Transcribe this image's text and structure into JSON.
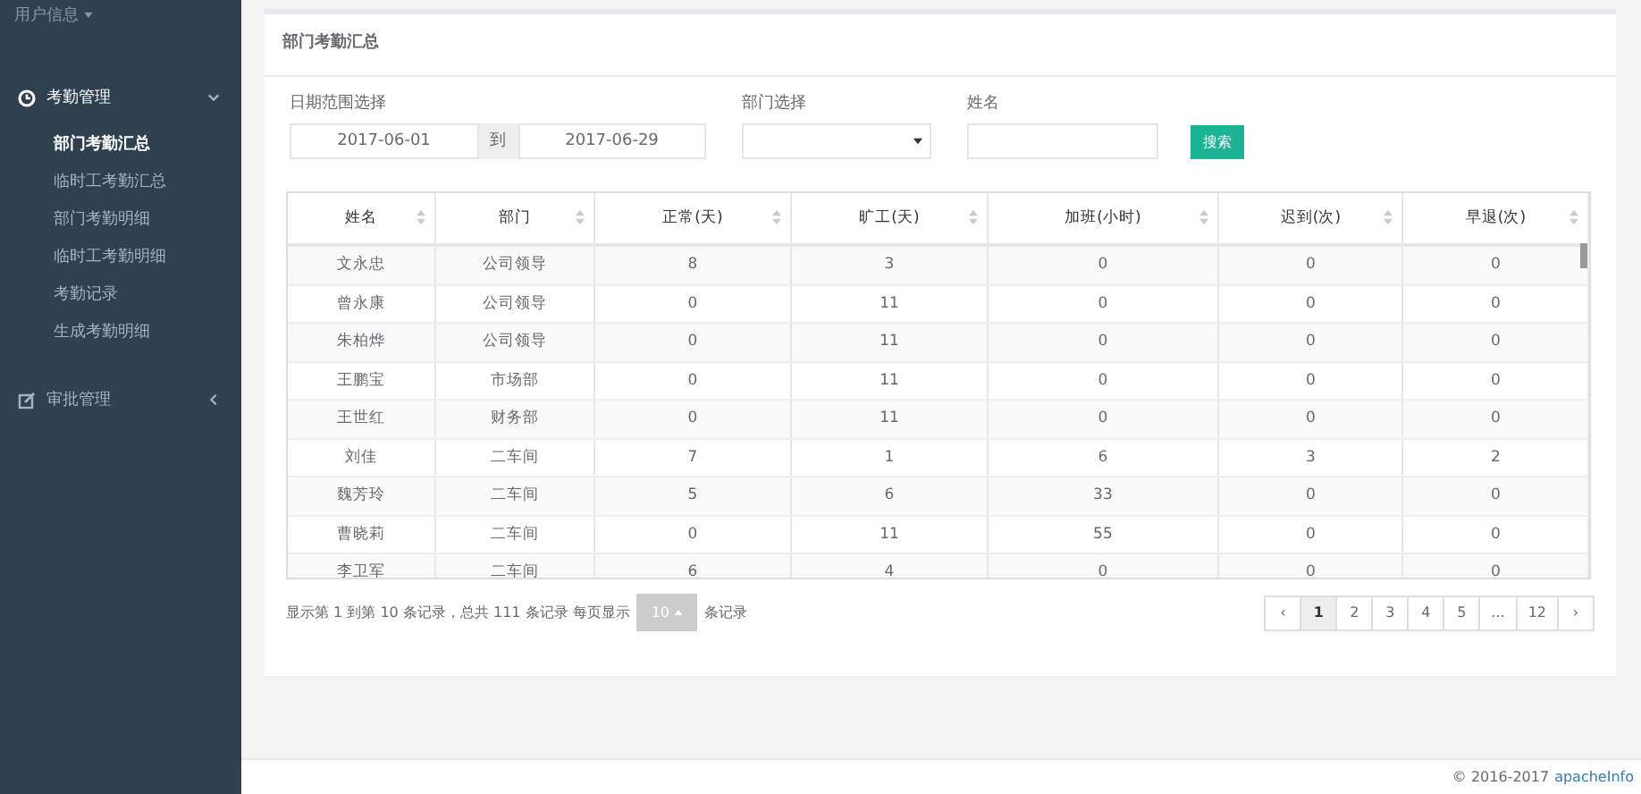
{
  "sidebar": {
    "user": {
      "label": "用户信息"
    },
    "menus": [
      {
        "label": "考勤管理",
        "expanded": true,
        "children": [
          {
            "label": "部门考勤汇总",
            "selected": true
          },
          {
            "label": "临时工考勤汇总",
            "selected": false
          },
          {
            "label": "部门考勤明细",
            "selected": false
          },
          {
            "label": "临时工考勤明细",
            "selected": false
          },
          {
            "label": "考勤记录",
            "selected": false
          },
          {
            "label": "生成考勤明细",
            "selected": false
          }
        ]
      },
      {
        "label": "审批管理",
        "expanded": false
      }
    ]
  },
  "panel": {
    "title": "部门考勤汇总",
    "filters": {
      "date_label": "日期范围选择",
      "date_from": "2017-06-01",
      "date_sep": "到",
      "date_to": "2017-06-29",
      "dept_label": "部门选择",
      "name_label": "姓名",
      "search_button": "搜索"
    },
    "table": {
      "columns": [
        "姓名",
        "部门",
        "正常(天)",
        "旷工(天)",
        "加班(小时)",
        "迟到(次)",
        "早退(次)"
      ],
      "rows": [
        [
          "文永忠",
          "公司领导",
          "8",
          "3",
          "0",
          "0",
          "0"
        ],
        [
          "曾永康",
          "公司领导",
          "0",
          "11",
          "0",
          "0",
          "0"
        ],
        [
          "朱柏烨",
          "公司领导",
          "0",
          "11",
          "0",
          "0",
          "0"
        ],
        [
          "王鹏宝",
          "市场部",
          "0",
          "11",
          "0",
          "0",
          "0"
        ],
        [
          "王世红",
          "财务部",
          "0",
          "11",
          "0",
          "0",
          "0"
        ],
        [
          "刘佳",
          "二车间",
          "7",
          "1",
          "6",
          "3",
          "2"
        ],
        [
          "魏芳玲",
          "二车间",
          "5",
          "6",
          "33",
          "0",
          "0"
        ],
        [
          "曹晓莉",
          "二车间",
          "0",
          "11",
          "55",
          "0",
          "0"
        ],
        [
          "李卫军",
          "二车间",
          "6",
          "4",
          "0",
          "0",
          "0"
        ]
      ]
    },
    "pagination": {
      "info_prefix": "显示第 1 到第 10 条记录，总共 111 条记录 每页显示",
      "page_size": "10",
      "info_suffix": "条记录",
      "pages": [
        {
          "label": "‹",
          "selected": false
        },
        {
          "label": "1",
          "selected": true
        },
        {
          "label": "2",
          "selected": false
        },
        {
          "label": "3",
          "selected": false
        },
        {
          "label": "4",
          "selected": false
        },
        {
          "label": "5",
          "selected": false
        },
        {
          "label": "...",
          "selected": false
        },
        {
          "label": "12",
          "selected": false
        },
        {
          "label": "›",
          "selected": false
        }
      ]
    }
  },
  "footer": {
    "copyright": "© 2016-2017",
    "link": "apacheInfo"
  }
}
